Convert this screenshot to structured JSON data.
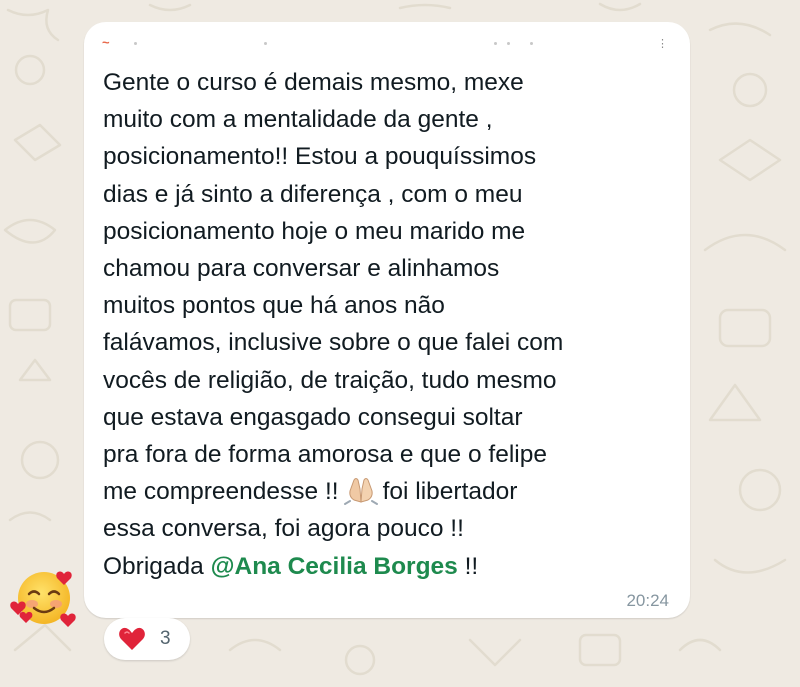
{
  "chat": {
    "message": {
      "text_before_emoji": "Gente o curso é demais mesmo, mexe\nmuito com a mentalidade da gente ,\nposicionamento!! Estou a pouquíssimos\ndias e já sinto a diferença , com o meu\nposicionamento hoje o meu marido me\nchamou para conversar e alinhamos\nmuitos pontos que há anos não\nfalávamos, inclusive sobre o que falei com\nvocês de religião, de traição, tudo mesmo\nque estava engasgado consegui soltar\npra fora de forma amorosa e que o felipe\nme compreendesse !!",
      "emoji_name": "praying-hands-icon",
      "text_after_emoji": "foi libertador\nessa conversa, foi agora pouco !!\nObrigada ",
      "mention": "@Ana Cecilia Borges",
      "text_end": " !!",
      "time": "20:24",
      "sender_mark": "~"
    },
    "reaction": {
      "emoji_name": "red-heart-icon",
      "count": "3"
    },
    "sticker_name": "smiling-face-with-hearts-icon",
    "colors": {
      "background": "#efeae2",
      "bubble": "#ffffff",
      "text": "#111b21",
      "mention": "#1e8a4e",
      "timestamp": "#8696a0",
      "heart": "#e0243a"
    }
  }
}
